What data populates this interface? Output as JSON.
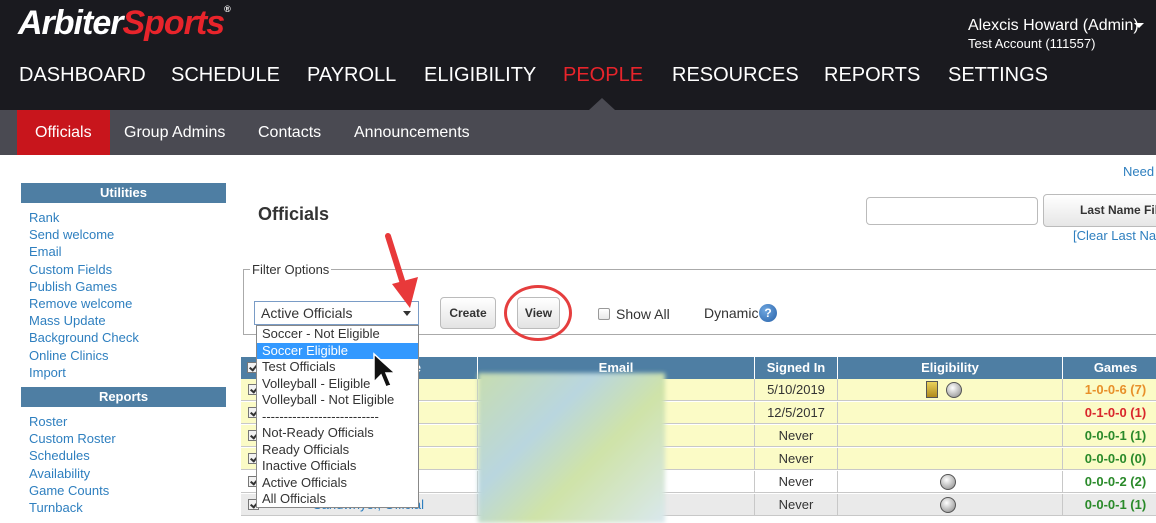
{
  "header": {
    "logo_part1": "Arbiter",
    "logo_part2": "Sports",
    "user_name": "Alexcis Howard (Admin)",
    "account": "Test Account (111557)"
  },
  "main_nav": [
    "DASHBOARD",
    "SCHEDULE",
    "PAYROLL",
    "ELIGIBILITY",
    "PEOPLE",
    "RESOURCES",
    "REPORTS",
    "SETTINGS"
  ],
  "main_nav_active": "PEOPLE",
  "sub_nav": [
    "Officials",
    "Group Admins",
    "Contacts",
    "Announcements"
  ],
  "sub_nav_active": "Officials",
  "sidebar": {
    "utilities_title": "Utilities",
    "utilities": [
      "Rank",
      "Send welcome",
      "Email",
      "Custom Fields",
      "Publish Games",
      "Remove welcome",
      "Mass Update",
      "Background Check",
      "Online Clinics",
      "Import"
    ],
    "reports_title": "Reports",
    "reports": [
      "Roster",
      "Custom Roster",
      "Schedules",
      "Availability",
      "Game Counts",
      "Turnback"
    ]
  },
  "help_link": "Need",
  "page_title": "Officials",
  "search": {
    "value": "",
    "button_label": "Last Name Fil",
    "clear_link": "[Clear Last Na"
  },
  "filter": {
    "legend": "Filter Options",
    "selected": "Active Officials",
    "create_label": "Create",
    "view_label": "View",
    "show_all_label": "Show All",
    "show_all_checked": false,
    "dynamic_label": "Dynamic",
    "help_glyph": "?"
  },
  "dropdown_options": [
    "Soccer - Not Eligible",
    "Soccer Eligible",
    "Test Officials",
    "Volleyball - Eligible",
    "Volleyball - Not Eligible",
    "---------------------------",
    "Not-Ready Officials",
    "Ready Officials",
    "Inactive Officials",
    "Active Officials",
    "All Officials"
  ],
  "dropdown_highlighted": "Soccer Eligible",
  "table": {
    "columns": [
      "e",
      "Email",
      "Signed In",
      "Eligibility",
      "Games"
    ],
    "rows": [
      {
        "signed_in": "5/10/2019",
        "games": "1-0-0-6 (7)",
        "games_color": "#e8902a",
        "eligibility": [
          "trophy",
          "ball"
        ],
        "bg": "yellow"
      },
      {
        "signed_in": "12/5/2017",
        "games": "0-1-0-0 (1)",
        "games_color": "#d9262c",
        "eligibility": [],
        "bg": "yellow"
      },
      {
        "signed_in": "Never",
        "games": "0-0-0-1 (1)",
        "games_color": "#2a8a2a",
        "eligibility": [],
        "bg": "yellow"
      },
      {
        "signed_in": "Never",
        "games": "0-0-0-0 (0)",
        "games_color": "#2a8a2a",
        "eligibility": [],
        "bg": "yellow"
      },
      {
        "signed_in": "Never",
        "games": "0-0-0-2 (2)",
        "games_color": "#2a8a2a",
        "eligibility": [
          "ball"
        ],
        "bg": "white"
      },
      {
        "signed_in": "Never",
        "games": "0-0-0-1 (1)",
        "games_color": "#2a8a2a",
        "eligibility": [
          "ball"
        ],
        "bg": "grey"
      }
    ]
  },
  "partial_name_link": "Sandwhyer, Official",
  "colors": {
    "top_bar": "#1a1a1f",
    "sub_bar": "#4a4a52",
    "accent_red": "#e8242b",
    "header_blue": "#4e7ea3",
    "link_blue": "#2e7fbf",
    "row_yellow": "#fbfbc6"
  }
}
